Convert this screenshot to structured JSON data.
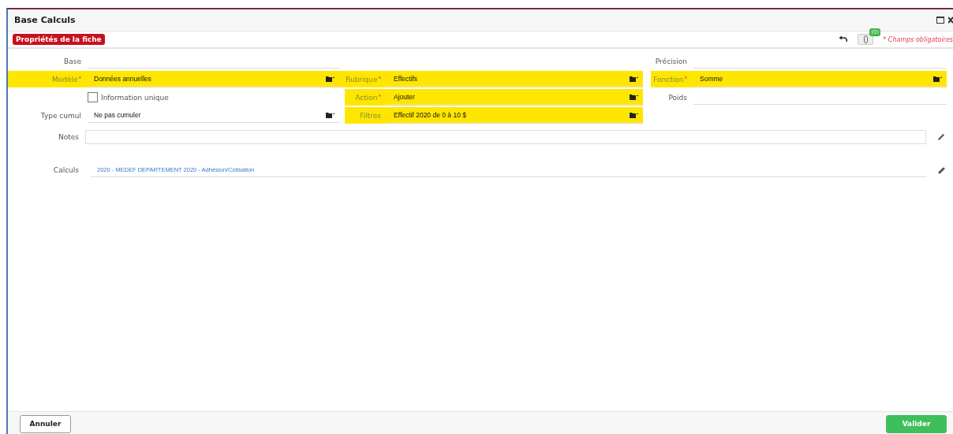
{
  "window": {
    "title": "Base Calculs"
  },
  "section_tab": {
    "label": "Propriétés de la fiche",
    "selected": true
  },
  "attachments": {
    "count": "(0)"
  },
  "required_note": "* Champs obligatoires",
  "rows": [
    {
      "left": {
        "kind": "text",
        "label": "Base",
        "highlighted": false
      },
      "right": {
        "kind": "text",
        "label": "Précision",
        "highlighted": false
      }
    },
    {
      "left": {
        "kind": "select",
        "label": "Modèle",
        "required_mark": "*",
        "value": "Données annuelles",
        "highlighted": true
      },
      "middle": {
        "kind": "select",
        "label": "Rubrique",
        "required_mark": "*",
        "value": "Effectifs",
        "highlighted": true
      },
      "right": {
        "kind": "select",
        "label": "Fonction",
        "required_mark": "*",
        "value": "Somme",
        "highlighted": true
      }
    },
    {
      "left": {
        "kind": "checkbox",
        "label": "Information unique",
        "checked": false
      },
      "middle": {
        "kind": "select",
        "label": "Action",
        "required_mark": "*",
        "value": "Ajouter",
        "highlighted": true
      },
      "right": {
        "kind": "text",
        "label": "Poids",
        "highlighted": false
      }
    },
    {
      "left": {
        "kind": "select",
        "label": "Type cumul",
        "value": "Ne pas cumuler",
        "highlighted": false
      },
      "middle": {
        "kind": "select",
        "label": "Filtres",
        "value": "Effectif 2020 de 0 à 10 $",
        "highlighted": true
      }
    }
  ],
  "notes": {
    "label": "Notes"
  },
  "calculs": {
    "label": "Calculs",
    "value": "2020 - MEDEF DEPARTEMENT 2020 - Adhésion/Cotisation"
  },
  "buttons": [
    {
      "label": "Annuler",
      "kind": "secondary"
    },
    {
      "label": "Valider",
      "kind": "primary"
    }
  ]
}
